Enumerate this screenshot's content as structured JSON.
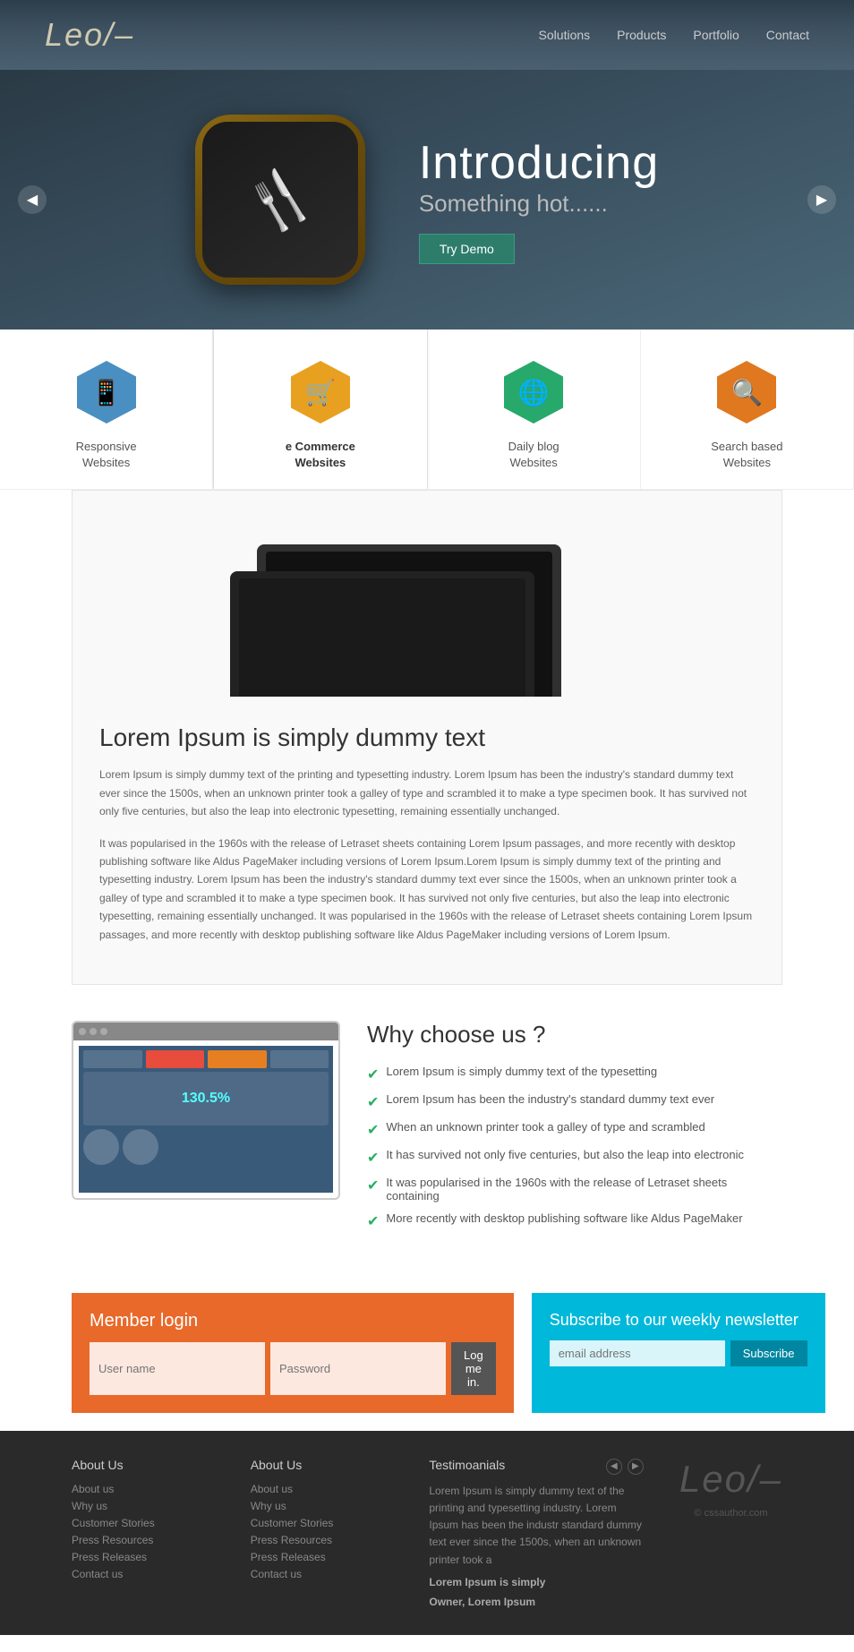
{
  "header": {
    "logo": "Leo/–",
    "nav": [
      {
        "label": "Solutions",
        "href": "#"
      },
      {
        "label": "Products",
        "href": "#"
      },
      {
        "label": "Portfolio",
        "href": "#"
      },
      {
        "label": "Contact",
        "href": "#"
      }
    ]
  },
  "hero": {
    "title": "Introducing",
    "subtitle": "Something hot......",
    "cta": "Try Demo",
    "arrow_left": "◀",
    "arrow_right": "▶"
  },
  "categories": [
    {
      "id": "responsive",
      "label1": "Responsive",
      "label2": "Websites",
      "color": "#4a8fc1",
      "active": false
    },
    {
      "id": "ecommerce",
      "label1": "e Commerce",
      "label2": "Websites",
      "color": "#e8a020",
      "active": true
    },
    {
      "id": "daily-blog",
      "label1": "Daily blog",
      "label2": "Websites",
      "color": "#27a96c",
      "active": false
    },
    {
      "id": "search-based",
      "label1": "Search based",
      "label2": "Websites",
      "color": "#e07820",
      "active": false
    }
  ],
  "content": {
    "title": "Lorem Ipsum is simply dummy text",
    "para1": "Lorem Ipsum is simply dummy text of the printing and typesetting industry. Lorem Ipsum has been the industry's standard dummy text ever since the 1500s, when an unknown printer took a galley of type and scrambled it to make a type specimen book. It has survived not only five centuries, but also the leap into electronic typesetting, remaining essentially unchanged.",
    "para2": "It was popularised in the 1960s with the release of Letraset sheets containing Lorem Ipsum passages, and more recently with desktop publishing software like Aldus PageMaker including versions of Lorem Ipsum.Lorem Ipsum is simply dummy text of the printing and typesetting industry. Lorem Ipsum has been the industry's standard dummy text ever since the 1500s, when an unknown printer took a galley of type and scrambled it to make a type specimen book. It has survived not only five centuries, but also the leap into electronic typesetting, remaining essentially unchanged. It was popularised in the 1960s with the release of Letraset sheets containing Lorem Ipsum passages, and more recently with desktop publishing software like Aldus PageMaker including versions of Lorem Ipsum."
  },
  "why": {
    "title": "Why choose us ?",
    "items": [
      "Lorem Ipsum is simply dummy text of the typesetting",
      "Lorem Ipsum has been the industry's standard dummy text ever",
      "When an unknown printer took a galley of type and scrambled",
      "It has survived not only five centuries, but also the leap into electronic",
      "It was popularised in the 1960s with the release of Letraset sheets containing",
      "More recently with desktop publishing software like Aldus PageMaker"
    ]
  },
  "member": {
    "title": "Member login",
    "username_placeholder": "User name",
    "password_placeholder": "Password",
    "login_btn": "Log me in."
  },
  "subscribe": {
    "title": "Subscribe to our weekly newsletter",
    "email_placeholder": "email address",
    "btn": "Subscribe"
  },
  "footer": {
    "col1_title": "About Us",
    "col1_links": [
      "About us",
      "Why us",
      "Customer Stories",
      "Press Resources",
      "Press Releases",
      "Contact us"
    ],
    "col2_title": "About Us",
    "col2_links": [
      "About us",
      "Why us",
      "Customer Stories",
      "Press Resources",
      "Press Releases",
      "Contact us"
    ],
    "testimonials_title": "Testimoanials",
    "testimonials_text": "Lorem Ipsum is simply dummy text of the printing and typesetting industry. Lorem Ipsum has been the industr standard dummy text ever since the 1500s, when an unknown printer took a",
    "testimonials_bold1": "Lorem Ipsum is simply",
    "testimonials_bold2": "Owner, Lorem Ipsum",
    "logo": "Leo/–",
    "copyright": "© cssauthor.com"
  }
}
